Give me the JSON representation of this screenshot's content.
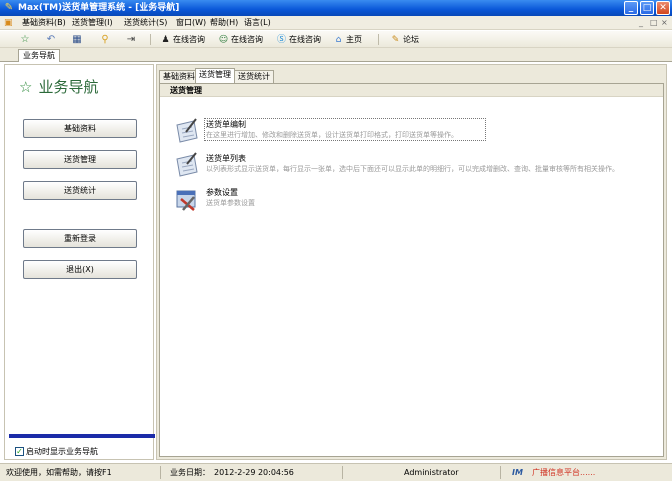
{
  "window": {
    "title": "Max(TM)送货单管理系统 - [业务导航]",
    "minimize_glyph": "_",
    "maximize_glyph": "□",
    "close_glyph": "✕"
  },
  "menu": {
    "items": [
      "基础资料(B)",
      "送货管理(I)",
      "送货统计(S)",
      "窗口(W)",
      "帮助(H)",
      "语言(L)"
    ],
    "mdi_controls": [
      "_",
      "□",
      "×"
    ]
  },
  "toolbar": {
    "buttons": [
      {
        "label": "在线咨询",
        "icon": "qq-penguin-icon"
      },
      {
        "label": "在线咨询",
        "icon": "chat-people-icon"
      },
      {
        "label": "在线咨询",
        "icon": "skype-icon"
      },
      {
        "label": "主页",
        "icon": "home-icon"
      },
      {
        "label": "论坛",
        "icon": "forum-icon"
      }
    ]
  },
  "doc_tab": {
    "label": "业务导航"
  },
  "nav": {
    "heading": "业务导航",
    "buttons": [
      "基础资料",
      "送货管理",
      "送货统计",
      "重新登录",
      "退出(X)"
    ],
    "startup_checkbox": {
      "label": "启动时显示业务导航",
      "checked": true
    }
  },
  "panel": {
    "tabs": [
      "基础资料",
      "送货管理",
      "送货统计"
    ],
    "active_tab": 1,
    "section_title": "送货管理",
    "entries": [
      {
        "name": "送货单编制",
        "desc": "在这里进行增加、修改和删除送货单，设计送货单打印格式，打印送货单等操作。",
        "icon": "edit-document-icon"
      },
      {
        "name": "送货单列表",
        "desc": "以列表形式显示送货单，每行显示一张单，选中后下面还可以显示此单的明细行，可以完成增删改、查询、批量审核等所有相关操作。",
        "icon": "document-list-icon"
      },
      {
        "name": "参数设置",
        "desc": "送货单参数设置",
        "icon": "settings-tools-icon"
      }
    ]
  },
  "status": {
    "welcome": "欢迎使用，如需帮助，请按F1",
    "date_label": "业务日期：",
    "date_value": "2012-2-29 20:04:56",
    "user": "Administrator",
    "platform": "广播信息平台......",
    "platform_icon_text": "IM"
  },
  "colors": {
    "title_blue": "#0a57d8",
    "nav_green": "#2c8a3a",
    "blue_bar": "#1b2ba8",
    "platform_red": "#d03020"
  }
}
